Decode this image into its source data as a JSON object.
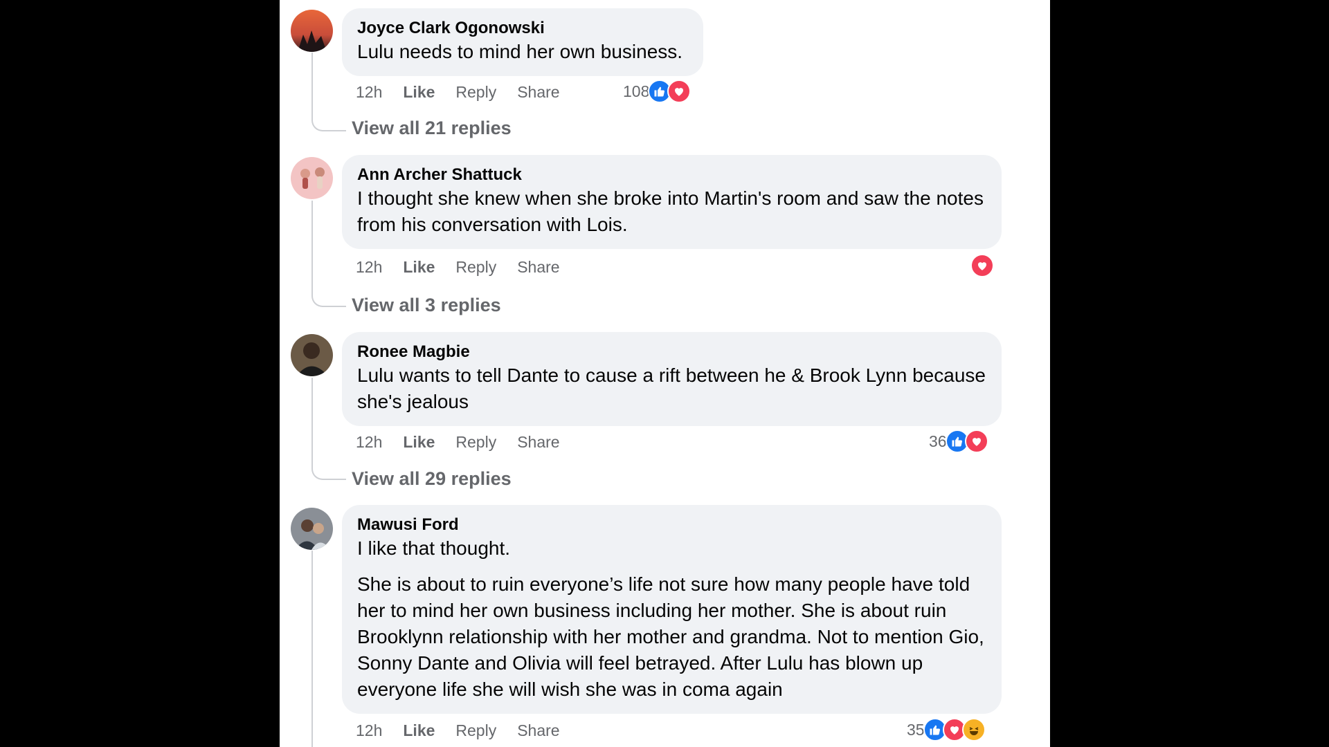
{
  "colors": {
    "background": "#000000",
    "panel": "#ffffff",
    "bubble": "#f0f2f5",
    "text_primary": "#050505",
    "text_secondary": "#65676b",
    "like_blue": "#1877f2",
    "love_red": "#f33e58",
    "haha_yellow": "#f7b125"
  },
  "actions": {
    "like": "Like",
    "reply": "Reply",
    "share": "Share"
  },
  "comments": [
    {
      "author": "Joyce Clark Ogonowski",
      "paragraphs": [
        "Lulu needs to mind her own business."
      ],
      "time": "12h",
      "reaction_count": "108",
      "reactions": [
        "like-icon",
        "love-icon"
      ],
      "view_replies": "View all 21 replies"
    },
    {
      "author": "Ann Archer Shattuck",
      "paragraphs": [
        "I thought she knew when she broke into Martin's room and saw the notes from his conversation with Lois."
      ],
      "time": "12h",
      "reaction_count": "",
      "reactions": [
        "love-icon"
      ],
      "view_replies": "View all 3 replies"
    },
    {
      "author": "Ronee Magbie",
      "paragraphs": [
        "Lulu wants to tell Dante to cause a rift between he & Brook Lynn because she's jealous"
      ],
      "time": "12h",
      "reaction_count": "36",
      "reactions": [
        "like-icon",
        "love-icon"
      ],
      "view_replies": "View all 29 replies"
    },
    {
      "author": "Mawusi Ford",
      "paragraphs": [
        "I like that thought.",
        "She is about to ruin everyone’s life not sure how many people have told her to mind her own business including her mother. She is about ruin Brooklynn relationship with her mother and grandma. Not to mention Gio, Sonny Dante and Olivia will feel betrayed. After Lulu has blown up everyone life she will wish she was in coma again"
      ],
      "time": "12h",
      "reaction_count": "35",
      "reactions": [
        "like-icon",
        "love-icon",
        "haha-icon"
      ],
      "view_replies": ""
    }
  ]
}
